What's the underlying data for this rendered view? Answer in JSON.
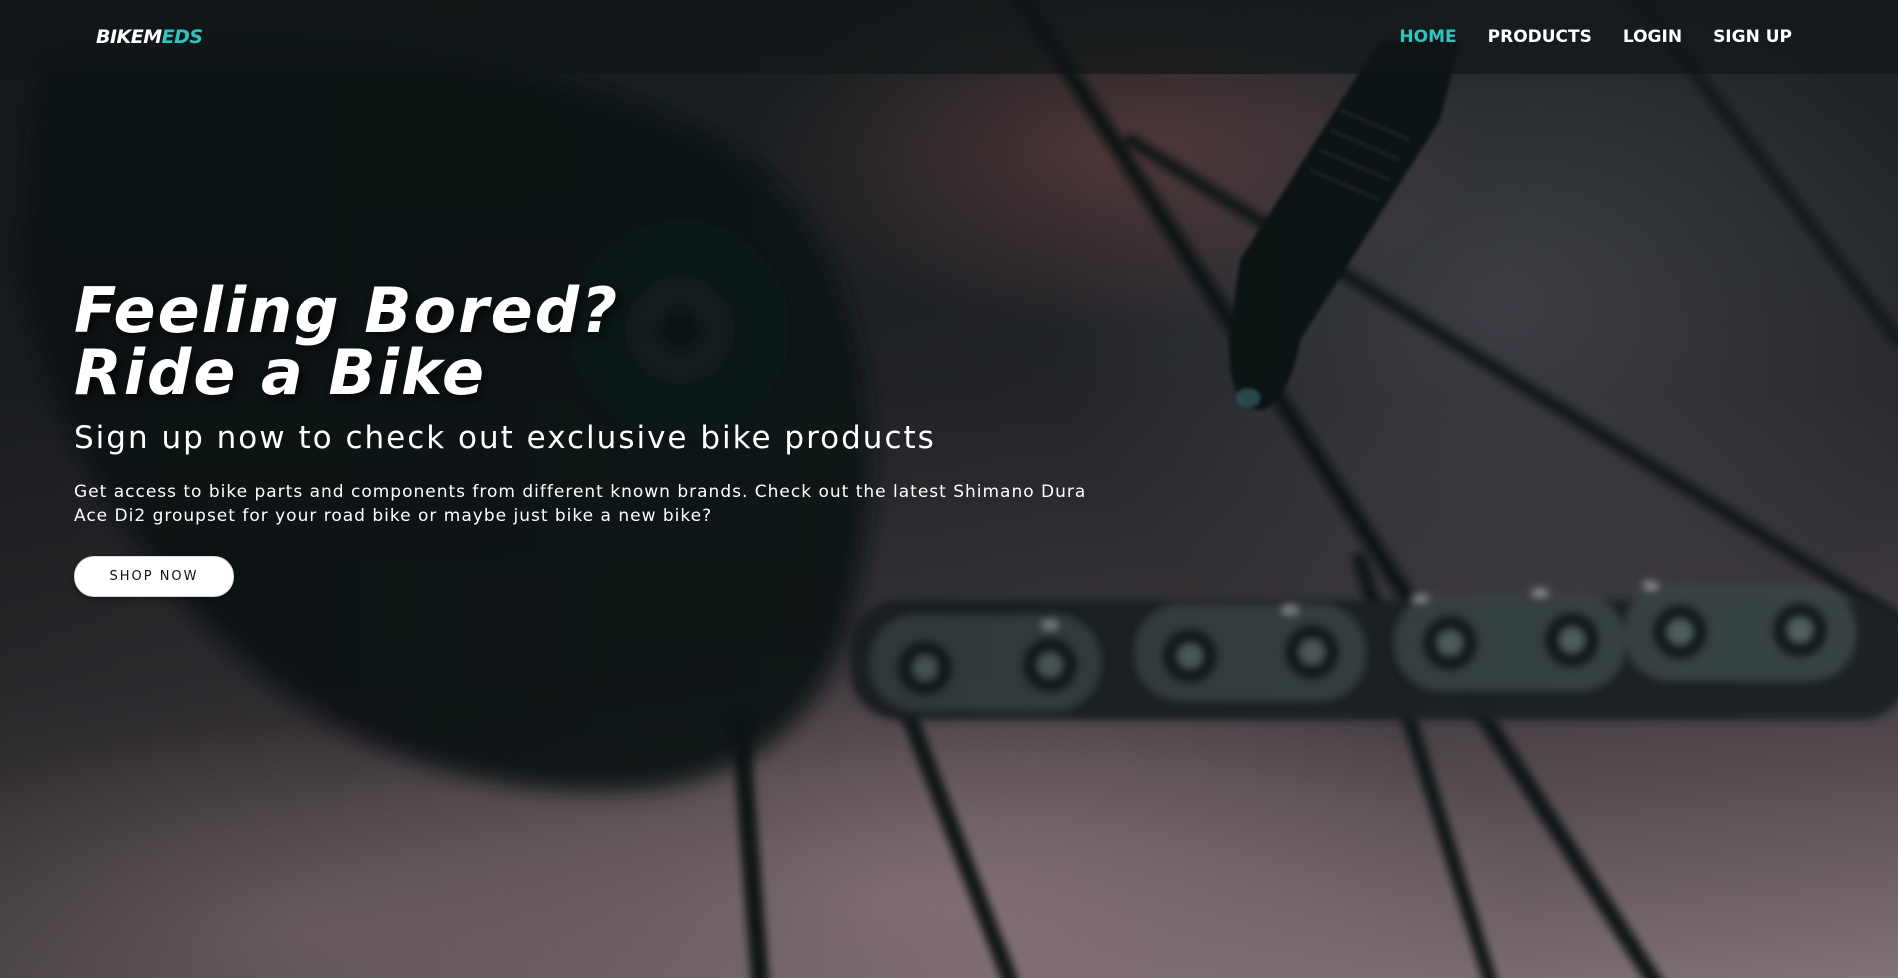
{
  "brand": {
    "logo_part1": "BIKEM",
    "logo_part2": "EDS",
    "accent_color": "#2ec4c0"
  },
  "nav": {
    "items": [
      {
        "label": "HOME",
        "active": true
      },
      {
        "label": "PRODUCTS",
        "active": false
      },
      {
        "label": "LOGIN",
        "active": false
      },
      {
        "label": "SIGN UP",
        "active": false
      }
    ]
  },
  "hero": {
    "headline_line1": "Feeling Bored?",
    "headline_line2": "Ride a Bike",
    "subheadline": "Sign up now to check out exclusive bike products",
    "description": "Get access to bike parts and components from different known brands. Check out the latest Shimano Dura Ace Di2 groupset for your road bike or maybe just bike a new bike?",
    "cta_label": "SHOP NOW",
    "background_image": "blurred-bike-chain-and-spokes"
  }
}
